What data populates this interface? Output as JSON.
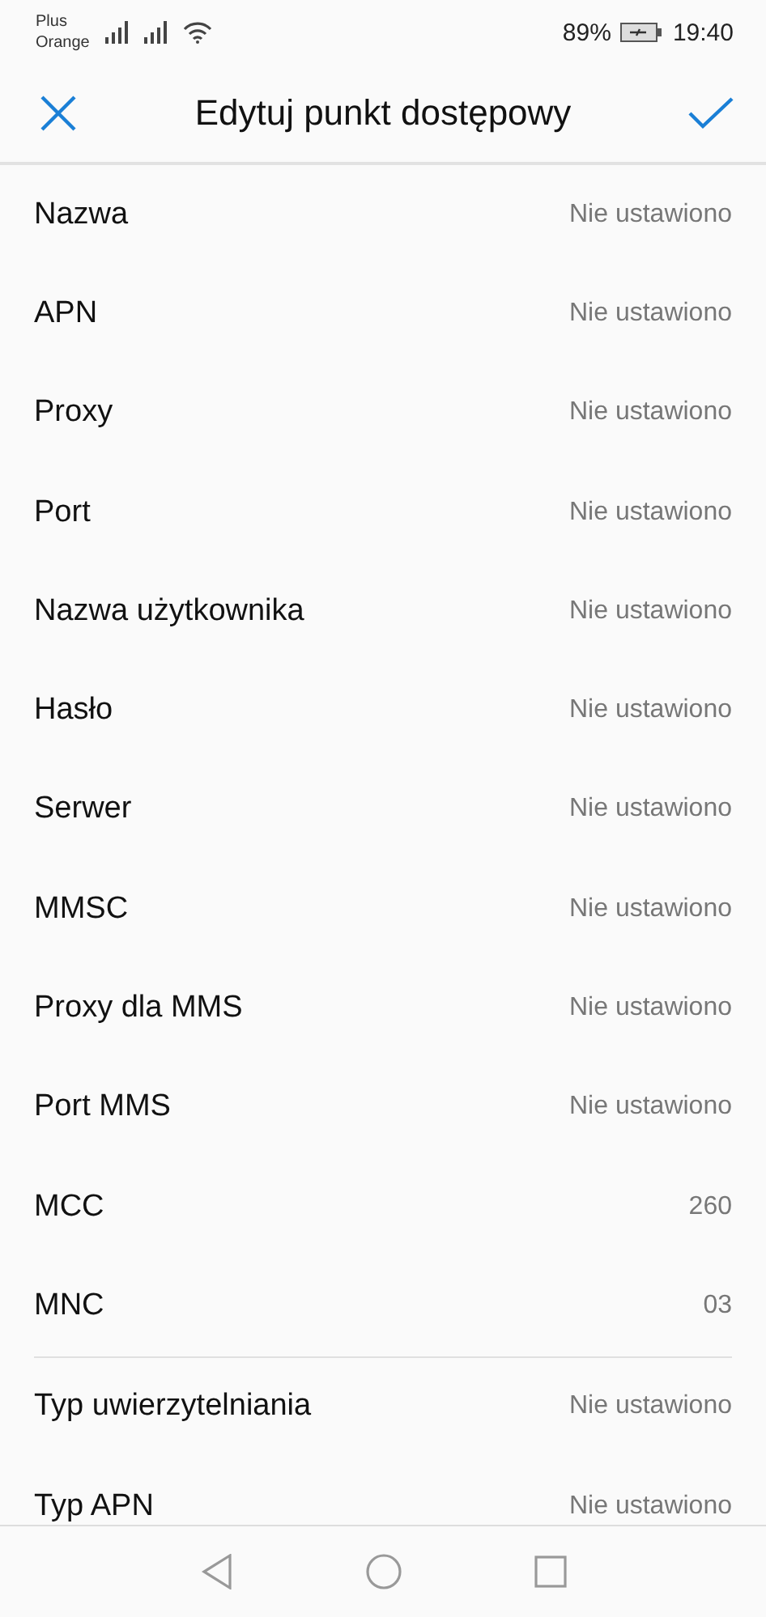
{
  "status_bar": {
    "carrier_1": "Plus",
    "carrier_2": "Orange",
    "battery": "89%",
    "time": "19:40"
  },
  "header": {
    "title": "Edytuj punkt dostępowy"
  },
  "groups": [
    [
      {
        "label": "Nazwa",
        "value": "Nie ustawiono"
      },
      {
        "label": "APN",
        "value": "Nie ustawiono"
      },
      {
        "label": "Proxy",
        "value": "Nie ustawiono"
      },
      {
        "label": "Port",
        "value": "Nie ustawiono"
      },
      {
        "label": "Nazwa użytkownika",
        "value": "Nie ustawiono"
      },
      {
        "label": "Hasło",
        "value": "Nie ustawiono"
      },
      {
        "label": "Serwer",
        "value": "Nie ustawiono"
      },
      {
        "label": "MMSC",
        "value": "Nie ustawiono"
      },
      {
        "label": "Proxy dla MMS",
        "value": "Nie ustawiono"
      },
      {
        "label": "Port MMS",
        "value": "Nie ustawiono"
      },
      {
        "label": "MCC",
        "value": "260"
      },
      {
        "label": "MNC",
        "value": "03"
      }
    ],
    [
      {
        "label": "Typ uwierzytelniania",
        "value": "Nie ustawiono"
      },
      {
        "label": "Typ APN",
        "value": "Nie ustawiono"
      }
    ]
  ]
}
